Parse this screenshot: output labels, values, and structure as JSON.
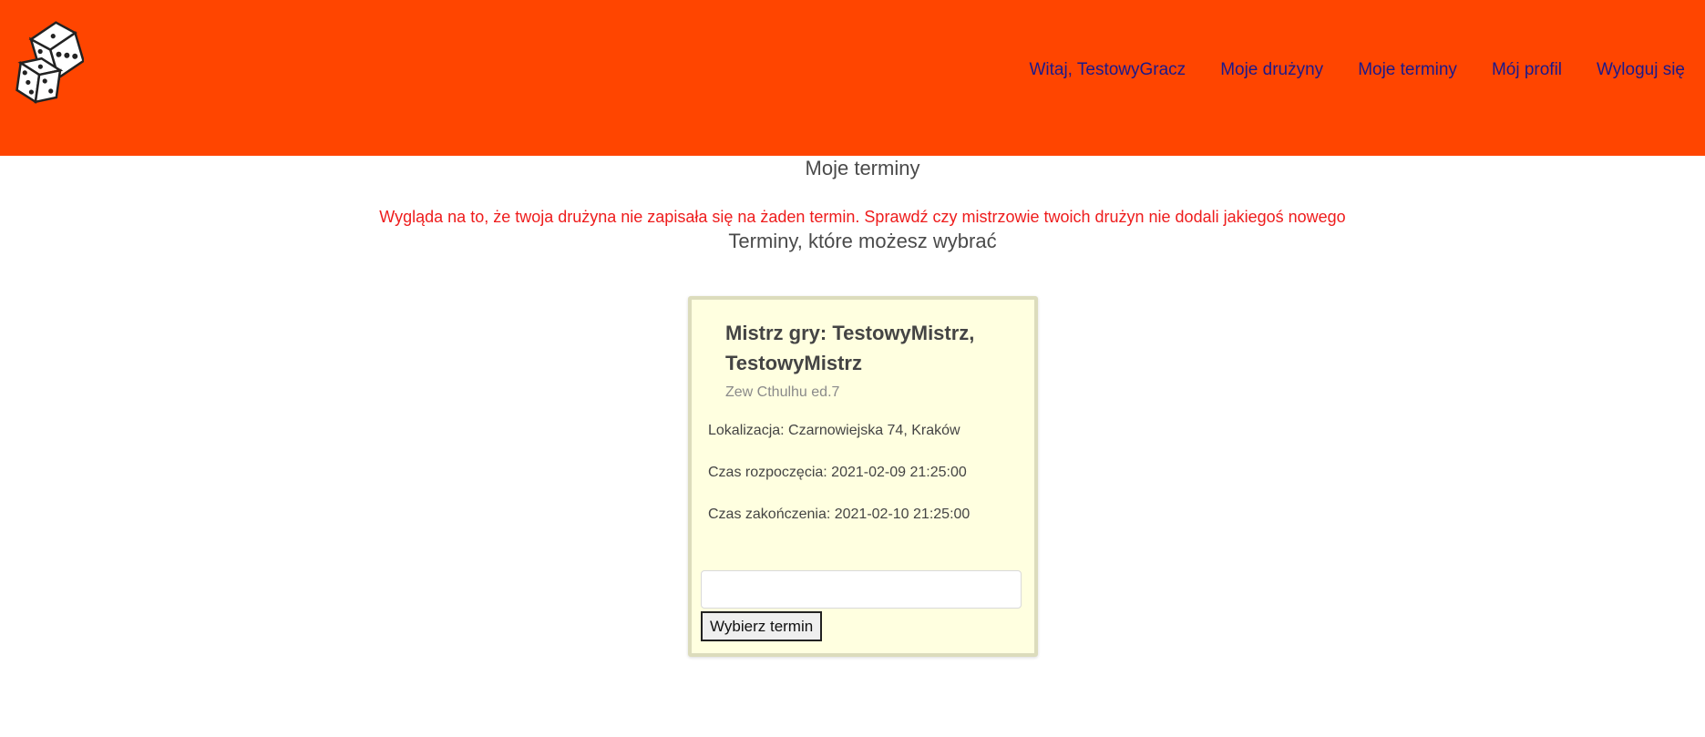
{
  "header": {
    "logo_icon": "dice-icon",
    "background_color": "#ff4500",
    "nav": {
      "welcome": "Witaj, TestowyGracz",
      "my_teams": "Moje drużyny",
      "my_dates": "Moje terminy",
      "my_profile": "Mój profil",
      "logout": "Wyloguj się"
    }
  },
  "main": {
    "title": "Moje terminy",
    "warning": "Wygląda na to, że twoja drużyna nie zapisała się na żaden termin. Sprawdź czy mistrzowie twoich drużyn nie dodali jakiegoś nowego",
    "subtitle": "Terminy, które możesz wybrać",
    "card": {
      "title": "Mistrz gry: TestowyMistrz, TestowyMistrz",
      "game": "Zew Cthulhu ed.7",
      "location": "Lokalizacja: Czarnowiejska 74, Kraków",
      "start": "Czas rozpoczęcia: 2021-02-09 21:25:00",
      "end": "Czas zakończenia: 2021-02-10 21:25:00",
      "input_value": "",
      "button_label": "Wybierz termin"
    }
  }
}
